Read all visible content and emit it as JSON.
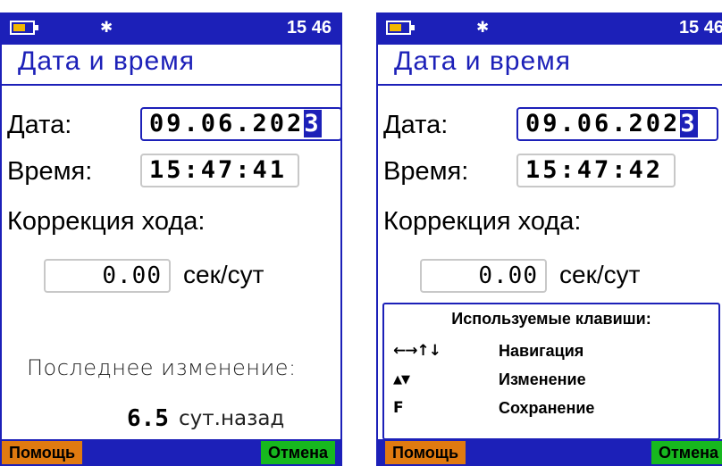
{
  "screens": [
    {
      "status": {
        "clock": "15 46",
        "bt_icon": "bluetooth-icon",
        "battery_icon": "battery-icon"
      },
      "title": "Дата и время",
      "date": {
        "label": "Дата:",
        "value": "09.06.202",
        "cursor_char": "3"
      },
      "time": {
        "label": "Время:",
        "value": "15:47:41"
      },
      "correction": {
        "label": "Коррекция хода:",
        "value": "0.00",
        "units": "сек/сут"
      },
      "last_change": {
        "label": "Последнее изменение:",
        "value": "6.5",
        "units": "сут.назад"
      },
      "buttons": {
        "help": "Помощь",
        "cancel": "Отмена"
      }
    },
    {
      "status": {
        "clock": "15 46",
        "bt_icon": "bluetooth-icon",
        "battery_icon": "battery-icon"
      },
      "title": "Дата и время",
      "date": {
        "label": "Дата:",
        "value": "09.06.202",
        "cursor_char": "3"
      },
      "time": {
        "label": "Время:",
        "value": "15:47:42"
      },
      "correction": {
        "label": "Коррекция хода:",
        "value": "0.00",
        "units": "сек/сут"
      },
      "keys_help": {
        "title": "Используемые клавиши:",
        "rows": [
          {
            "keys": "←→↑↓",
            "desc": "Навигация"
          },
          {
            "keys": "▲▼",
            "desc": "Изменение"
          },
          {
            "keys": "F",
            "desc": "Сохранение"
          }
        ]
      },
      "buttons": {
        "help": "Помощь",
        "cancel": "Отмена"
      }
    }
  ],
  "colors": {
    "accent": "#1c20b8",
    "help_button": "#e07a10",
    "cancel_button": "#17b81f",
    "battery": "#f2b800"
  }
}
